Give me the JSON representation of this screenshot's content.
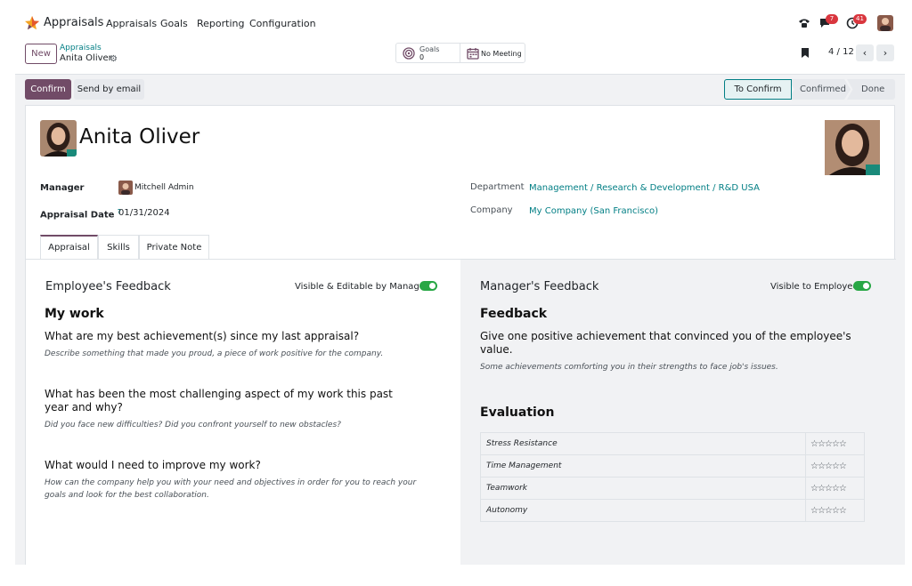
{
  "navbar": {
    "app_name": "Appraisals",
    "menu": [
      "Appraisals",
      "Goals",
      "Reporting",
      "Configuration"
    ],
    "messages_count": "7",
    "activities_count": "41",
    "icons": [
      "phone-icon",
      "chat-icon",
      "clock-icon"
    ],
    "brand_color": "#714b67"
  },
  "control": {
    "new_label": "New",
    "breadcrumb_parent": "Appraisals",
    "breadcrumb_current": "Anita Oliver",
    "goals_label": "Goals",
    "goals_count": "0",
    "meeting_label": "No Meeting",
    "pager": "4 / 12",
    "prev": "‹",
    "next": "›"
  },
  "actions": {
    "confirm_label": "Confirm",
    "email_label": "Send by email"
  },
  "stages": [
    "To Confirm",
    "Confirmed",
    "Done"
  ],
  "employee": {
    "name": "Anita Oliver",
    "manager_label": "Manager",
    "manager": "Mitchell Admin",
    "date_label": "Appraisal Date",
    "date_help": "?",
    "date": "01/31/2024",
    "department_label": "Department",
    "department": "Management / Research & Development / R&D USA",
    "company_label": "Company",
    "company": "My Company (San Francisco)"
  },
  "tabs": [
    "Appraisal",
    "Skills",
    "Private Note"
  ],
  "employee_feedback": {
    "title": "Employee's Feedback",
    "toggle_label": "Visible & Editable by Manager",
    "section": "My work",
    "q1": "What are my best achievement(s) since my last appraisal?",
    "h1": "Describe something that made you proud, a piece of work positive for the company.",
    "q2": "What has been the most challenging aspect of my work this past year and why?",
    "h2": "Did you face new difficulties? Did you confront yourself to new obstacles?",
    "q3": "What would I need to improve my work?",
    "h3": "How can the company help you with your need and objectives in order for you to reach your goals and look for the best collaboration."
  },
  "manager_feedback": {
    "title": "Manager's Feedback",
    "toggle_label": "Visible to Employee",
    "section": "Feedback",
    "q1": "Give one positive achievement that convinced you of the employee's value.",
    "h1": "Some achievements comforting you in their strengths to face job's issues.",
    "evaluation_title": "Evaluation",
    "criteria": [
      {
        "name": "Stress Resistance",
        "stars": "☆☆☆☆☆"
      },
      {
        "name": "Time Management",
        "stars": "☆☆☆☆☆"
      },
      {
        "name": "Teamwork",
        "stars": "☆☆☆☆☆"
      },
      {
        "name": "Autonomy",
        "stars": "☆☆☆☆☆"
      }
    ]
  }
}
